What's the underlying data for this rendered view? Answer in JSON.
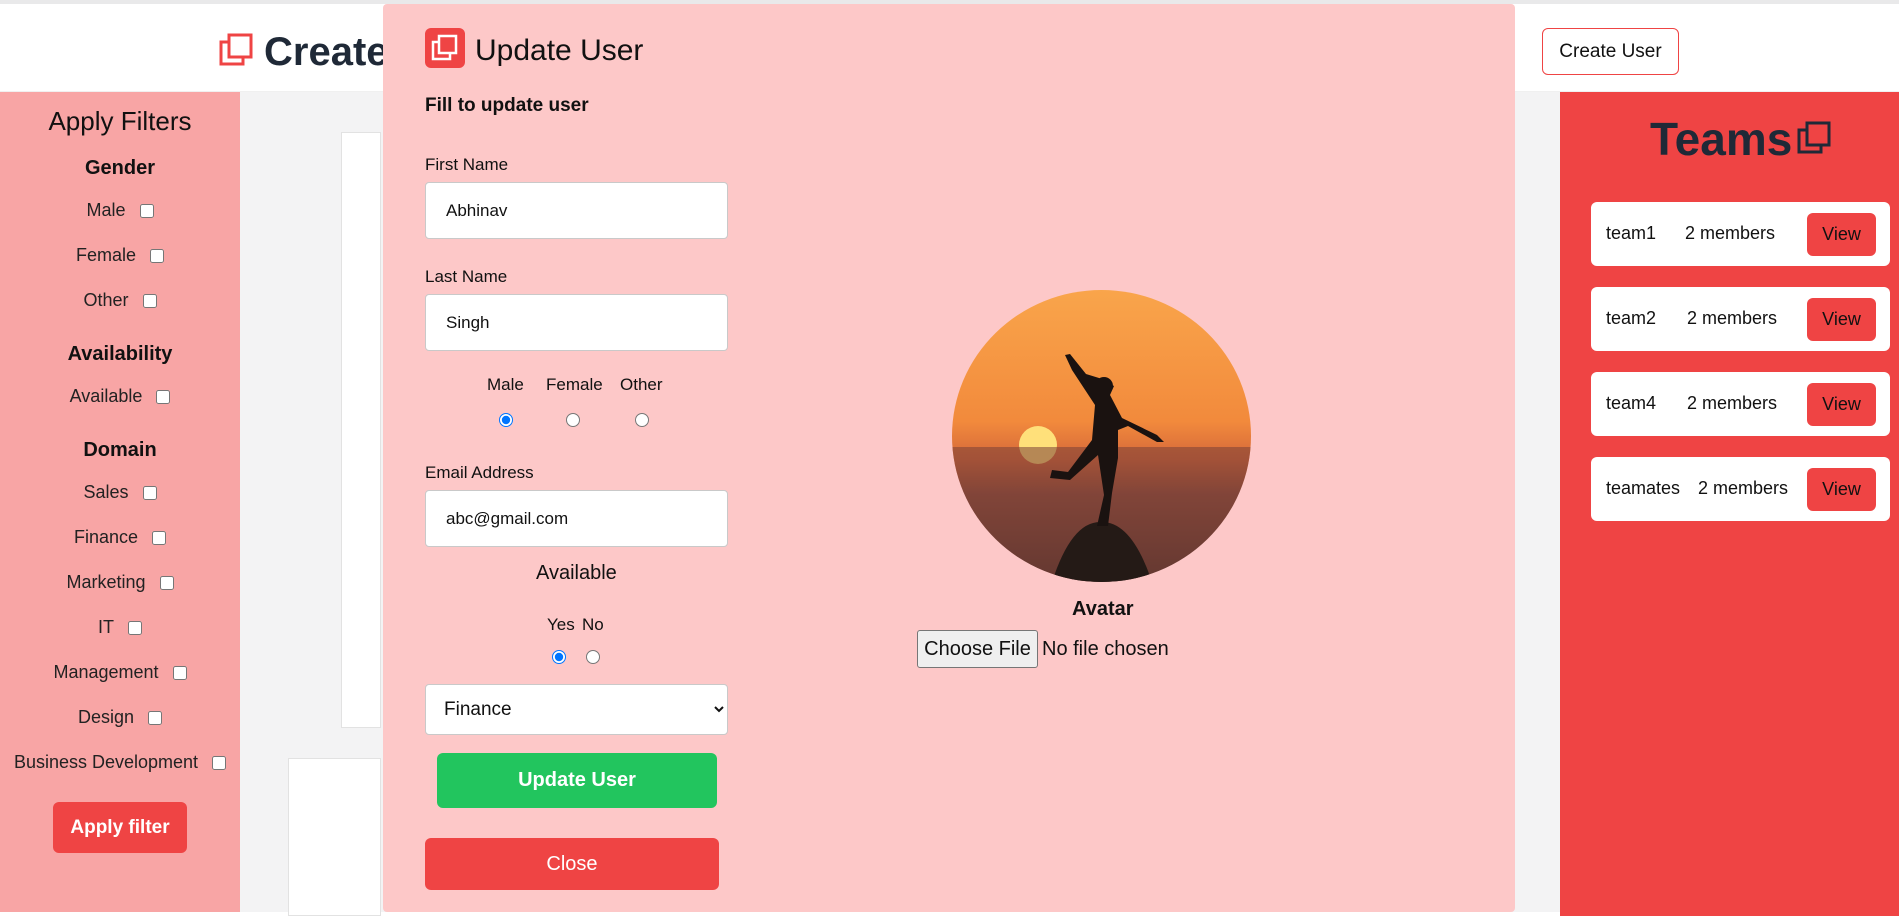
{
  "header": {
    "brand": "Create",
    "create_user_label": "Create User"
  },
  "filters": {
    "title": "Apply Filters",
    "gender": {
      "title": "Gender",
      "options": [
        "Male",
        "Female",
        "Other"
      ]
    },
    "availability": {
      "title": "Availability",
      "options": [
        "Available"
      ]
    },
    "domain": {
      "title": "Domain",
      "options": [
        "Sales",
        "Finance",
        "Marketing",
        "IT",
        "Management",
        "Design",
        "Business Development"
      ]
    },
    "apply_label": "Apply filter"
  },
  "teams": {
    "title": "Teams",
    "items": [
      {
        "name": "team1",
        "members": "2 members",
        "view": "View"
      },
      {
        "name": "team2",
        "members": "2 members",
        "view": "View"
      },
      {
        "name": "team4",
        "members": "2 members",
        "view": "View"
      },
      {
        "name": "teamates",
        "members": "2 members",
        "view": "View"
      }
    ]
  },
  "modal": {
    "title": "Update User",
    "subtitle": "Fill to update user",
    "first_name_label": "First Name",
    "first_name_value": "Abhinav",
    "last_name_label": "Last Name",
    "last_name_value": "Singh",
    "gender_options": [
      "Male",
      "Female",
      "Other"
    ],
    "gender_selected": "Male",
    "email_label": "Email Address",
    "email_value": "abc@gmail.com",
    "available_title": "Available",
    "available_options": [
      "Yes",
      "No"
    ],
    "available_selected": "Yes",
    "domain_value": "Finance",
    "update_label": "Update User",
    "close_label": "Close",
    "avatar_label": "Avatar",
    "choose_file_label": "Choose File",
    "no_file_text": "No file chosen"
  },
  "colors": {
    "accent": "#ef4444",
    "modal_bg": "#fdc8c8",
    "filters_bg": "#f8a5a5",
    "success": "#22c55e"
  }
}
